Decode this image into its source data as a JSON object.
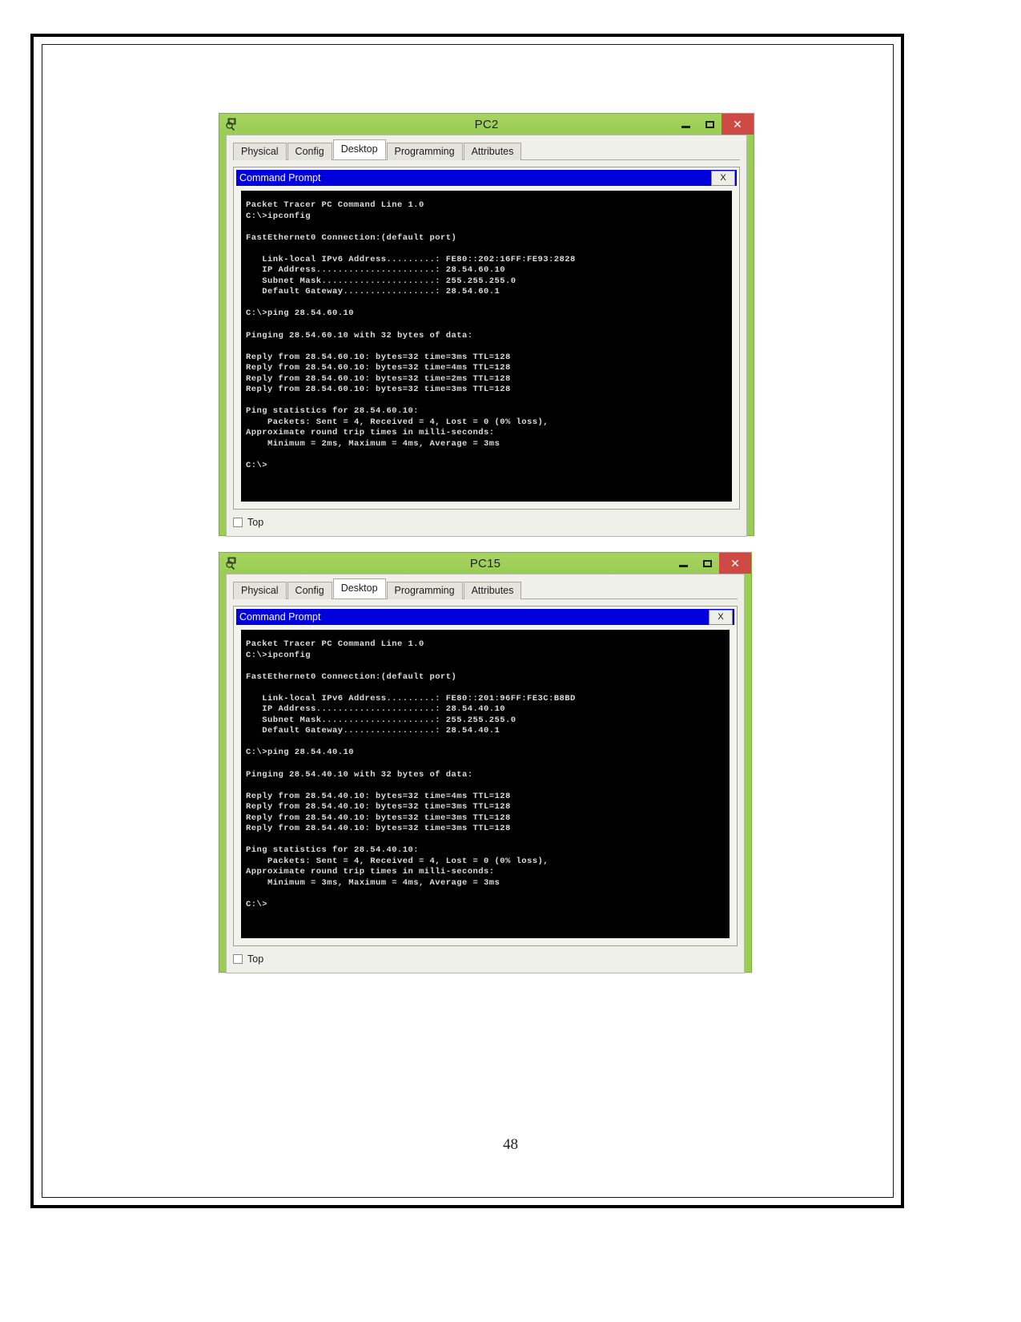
{
  "document": {
    "page_number": "48"
  },
  "windows": [
    {
      "title": "PC2",
      "icon": "packet-tracer-pc-icon",
      "controls": {
        "minimize": "–",
        "maximize": "□",
        "close": "✕"
      },
      "tabs": [
        {
          "label": "Physical",
          "active": false
        },
        {
          "label": "Config",
          "active": false
        },
        {
          "label": "Desktop",
          "active": true
        },
        {
          "label": "Programming",
          "active": false
        },
        {
          "label": "Attributes",
          "active": false
        }
      ],
      "cmd": {
        "title": "Command Prompt",
        "close_label": "X",
        "output": "Packet Tracer PC Command Line 1.0\nC:\\>ipconfig\n\nFastEthernet0 Connection:(default port)\n\n   Link-local IPv6 Address.........: FE80::202:16FF:FE93:2828\n   IP Address......................: 28.54.60.10\n   Subnet Mask.....................: 255.255.255.0\n   Default Gateway.................: 28.54.60.1\n\nC:\\>ping 28.54.60.10\n\nPinging 28.54.60.10 with 32 bytes of data:\n\nReply from 28.54.60.10: bytes=32 time=3ms TTL=128\nReply from 28.54.60.10: bytes=32 time=4ms TTL=128\nReply from 28.54.60.10: bytes=32 time=2ms TTL=128\nReply from 28.54.60.10: bytes=32 time=3ms TTL=128\n\nPing statistics for 28.54.60.10:\n    Packets: Sent = 4, Received = 4, Lost = 0 (0% loss),\nApproximate round trip times in milli-seconds:\n    Minimum = 2ms, Maximum = 4ms, Average = 3ms\n\nC:\\>"
      },
      "footer": {
        "checkbox_label": "Top",
        "checked": false
      }
    },
    {
      "title": "PC15",
      "icon": "packet-tracer-pc-icon",
      "controls": {
        "minimize": "–",
        "maximize": "□",
        "close": "✕"
      },
      "tabs": [
        {
          "label": "Physical",
          "active": false
        },
        {
          "label": "Config",
          "active": false
        },
        {
          "label": "Desktop",
          "active": true
        },
        {
          "label": "Programming",
          "active": false
        },
        {
          "label": "Attributes",
          "active": false
        }
      ],
      "cmd": {
        "title": "Command Prompt",
        "close_label": "X",
        "output": "Packet Tracer PC Command Line 1.0\nC:\\>ipconfig\n\nFastEthernet0 Connection:(default port)\n\n   Link-local IPv6 Address.........: FE80::201:96FF:FE3C:B8BD\n   IP Address......................: 28.54.40.10\n   Subnet Mask.....................: 255.255.255.0\n   Default Gateway.................: 28.54.40.1\n\nC:\\>ping 28.54.40.10\n\nPinging 28.54.40.10 with 32 bytes of data:\n\nReply from 28.54.40.10: bytes=32 time=4ms TTL=128\nReply from 28.54.40.10: bytes=32 time=3ms TTL=128\nReply from 28.54.40.10: bytes=32 time=3ms TTL=128\nReply from 28.54.40.10: bytes=32 time=3ms TTL=128\n\nPing statistics for 28.54.40.10:\n    Packets: Sent = 4, Received = 4, Lost = 0 (0% loss),\nApproximate round trip times in milli-seconds:\n    Minimum = 3ms, Maximum = 4ms, Average = 3ms\n\nC:\\>"
      },
      "footer": {
        "checkbox_label": "Top",
        "checked": false
      }
    }
  ],
  "colors": {
    "window_chrome": "#9ACD54",
    "close_button": "#cf4a44",
    "cmd_titlebar": "#0000dd",
    "terminal_bg": "#000000",
    "terminal_fg": "#dcdcdc"
  }
}
